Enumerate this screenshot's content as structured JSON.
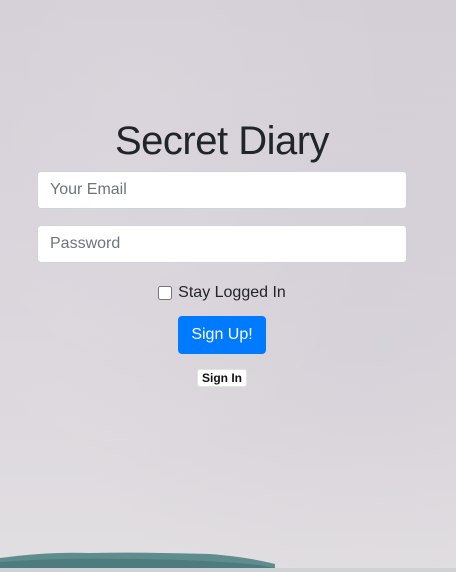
{
  "page": {
    "title": "Secret Diary"
  },
  "form": {
    "email_placeholder": "Your Email",
    "password_placeholder": "Password",
    "stay_logged_in_label": "Stay Logged In",
    "stay_logged_in_checked": false,
    "signup_label": "Sign Up!",
    "signin_label": "Sign In"
  },
  "colors": {
    "primary": "#007bff",
    "background": "#d8d3da"
  }
}
